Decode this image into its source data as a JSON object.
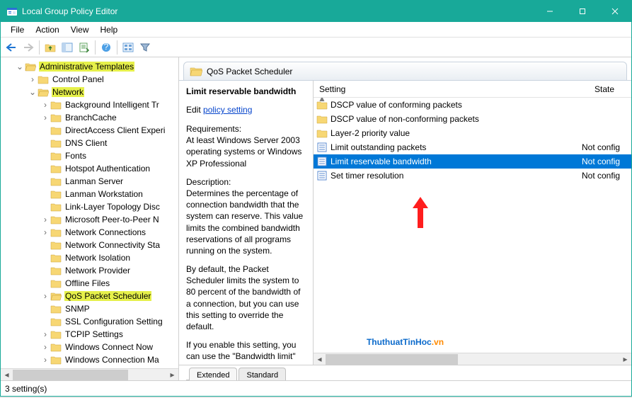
{
  "window": {
    "title": "Local Group Policy Editor"
  },
  "menubar": {
    "items": [
      "File",
      "Action",
      "View",
      "Help"
    ]
  },
  "tree": {
    "root": "Administrative Templates",
    "cp": "Control Panel",
    "net": "Network",
    "children": [
      "Background Intelligent Tr",
      "BranchCache",
      "DirectAccess Client Experi",
      "DNS Client",
      "Fonts",
      "Hotspot Authentication",
      "Lanman Server",
      "Lanman Workstation",
      "Link-Layer Topology Disc",
      "Microsoft Peer-to-Peer N",
      "Network Connections",
      "Network Connectivity Sta",
      "Network Isolation",
      "Network Provider",
      "Offline Files",
      "QoS Packet Scheduler",
      "SNMP",
      "SSL Configuration Setting",
      "TCPIP Settings",
      "Windows Connect Now",
      "Windows Connection Ma"
    ]
  },
  "header": {
    "title": "QoS Packet Scheduler"
  },
  "desc": {
    "title": "Limit reservable bandwidth",
    "edit_prefix": "Edit ",
    "edit_link": "policy setting ",
    "req_h": "Requirements:",
    "req_body": "At least Windows Server 2003 operating systems or Windows XP Professional",
    "d_h": "Description:",
    "d_body1": "Determines the percentage of connection bandwidth that the system can reserve. This value limits the combined bandwidth reservations of all programs running on the system.",
    "d_body2": "By default, the Packet Scheduler limits the system to 80 percent of the bandwidth of a connection, but you can use this setting to override the default.",
    "d_body3": "If you enable this setting, you can use the \"Bandwidth limit\" box to adjust the amount of bandwidth the system can reserve."
  },
  "list": {
    "col_setting": "Setting",
    "col_state": "State",
    "items": [
      {
        "type": "folder",
        "label": "DSCP value of conforming packets",
        "state": ""
      },
      {
        "type": "folder",
        "label": "DSCP value of non-conforming packets",
        "state": ""
      },
      {
        "type": "folder",
        "label": "Layer-2 priority value",
        "state": ""
      },
      {
        "type": "policy",
        "label": "Limit outstanding packets",
        "state": "Not config"
      },
      {
        "type": "policy",
        "label": "Limit reservable bandwidth",
        "state": "Not config",
        "selected": true
      },
      {
        "type": "policy",
        "label": "Set timer resolution",
        "state": "Not config"
      }
    ]
  },
  "tabs": {
    "extended": "Extended",
    "standard": "Standard"
  },
  "status": {
    "text": "3 setting(s)"
  },
  "watermark": {
    "a": "ThuthuatTinHoc",
    "b": ".vn"
  }
}
